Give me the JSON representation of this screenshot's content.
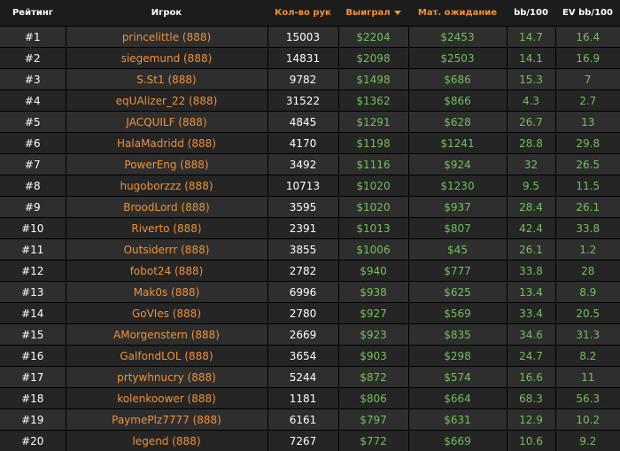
{
  "columns": {
    "rank": "Рейтинг",
    "player": "Игрок",
    "hands": "Кол-во рук",
    "won": "Выиграл",
    "ev": "Мат. ожидание",
    "bb100": "bb/100",
    "evbb100": "EV bb/100"
  },
  "sort": {
    "column": "won",
    "direction": "desc",
    "icon": "sort-desc-icon"
  },
  "colors": {
    "accent": "#f0913a",
    "positive": "#72c05a",
    "background": "#1c1c1c"
  },
  "rows": [
    {
      "rank": "#1",
      "player": "princelittle (888)",
      "hands": "15003",
      "won": "$2204",
      "ev": "$2453",
      "bb": "14.7",
      "evbb": "16.4"
    },
    {
      "rank": "#2",
      "player": "siegemund (888)",
      "hands": "14831",
      "won": "$2098",
      "ev": "$2503",
      "bb": "14.1",
      "evbb": "16.9"
    },
    {
      "rank": "#3",
      "player": "S.St1 (888)",
      "hands": "9782",
      "won": "$1498",
      "ev": "$686",
      "bb": "15.3",
      "evbb": "7"
    },
    {
      "rank": "#4",
      "player": "eqUAlizer_22 (888)",
      "hands": "31522",
      "won": "$1362",
      "ev": "$866",
      "bb": "4.3",
      "evbb": "2.7"
    },
    {
      "rank": "#5",
      "player": "JACQUILF (888)",
      "hands": "4845",
      "won": "$1291",
      "ev": "$628",
      "bb": "26.7",
      "evbb": "13"
    },
    {
      "rank": "#6",
      "player": "HalaMadridd (888)",
      "hands": "4170",
      "won": "$1198",
      "ev": "$1241",
      "bb": "28.8",
      "evbb": "29.8"
    },
    {
      "rank": "#7",
      "player": "PowerEng (888)",
      "hands": "3492",
      "won": "$1116",
      "ev": "$924",
      "bb": "32",
      "evbb": "26.5"
    },
    {
      "rank": "#8",
      "player": "hugoborzzz (888)",
      "hands": "10713",
      "won": "$1020",
      "ev": "$1230",
      "bb": "9.5",
      "evbb": "11.5"
    },
    {
      "rank": "#9",
      "player": "BroodLord (888)",
      "hands": "3595",
      "won": "$1020",
      "ev": "$937",
      "bb": "28.4",
      "evbb": "26.1"
    },
    {
      "rank": "#10",
      "player": "Riverto (888)",
      "hands": "2391",
      "won": "$1013",
      "ev": "$807",
      "bb": "42.4",
      "evbb": "33.8"
    },
    {
      "rank": "#11",
      "player": "Outsiderrr (888)",
      "hands": "3855",
      "won": "$1006",
      "ev": "$45",
      "bb": "26.1",
      "evbb": "1.2"
    },
    {
      "rank": "#12",
      "player": "fobot24 (888)",
      "hands": "2782",
      "won": "$940",
      "ev": "$777",
      "bb": "33.8",
      "evbb": "28"
    },
    {
      "rank": "#13",
      "player": "Mak0s (888)",
      "hands": "6996",
      "won": "$938",
      "ev": "$625",
      "bb": "13.4",
      "evbb": "8.9"
    },
    {
      "rank": "#14",
      "player": "GoVIes (888)",
      "hands": "2780",
      "won": "$927",
      "ev": "$569",
      "bb": "33.4",
      "evbb": "20.5"
    },
    {
      "rank": "#15",
      "player": "AMorgenstern (888)",
      "hands": "2669",
      "won": "$923",
      "ev": "$835",
      "bb": "34.6",
      "evbb": "31.3"
    },
    {
      "rank": "#16",
      "player": "GalfondLOL (888)",
      "hands": "3654",
      "won": "$903",
      "ev": "$298",
      "bb": "24.7",
      "evbb": "8.2"
    },
    {
      "rank": "#17",
      "player": "prtywhnucry (888)",
      "hands": "5244",
      "won": "$872",
      "ev": "$574",
      "bb": "16.6",
      "evbb": "11"
    },
    {
      "rank": "#18",
      "player": "kolenkoower (888)",
      "hands": "1181",
      "won": "$806",
      "ev": "$664",
      "bb": "68.3",
      "evbb": "56.3"
    },
    {
      "rank": "#19",
      "player": "PaymePlz7777 (888)",
      "hands": "6161",
      "won": "$797",
      "ev": "$631",
      "bb": "12.9",
      "evbb": "10.2"
    },
    {
      "rank": "#20",
      "player": "legend (888)",
      "hands": "7267",
      "won": "$772",
      "ev": "$669",
      "bb": "10.6",
      "evbb": "9.2"
    }
  ]
}
